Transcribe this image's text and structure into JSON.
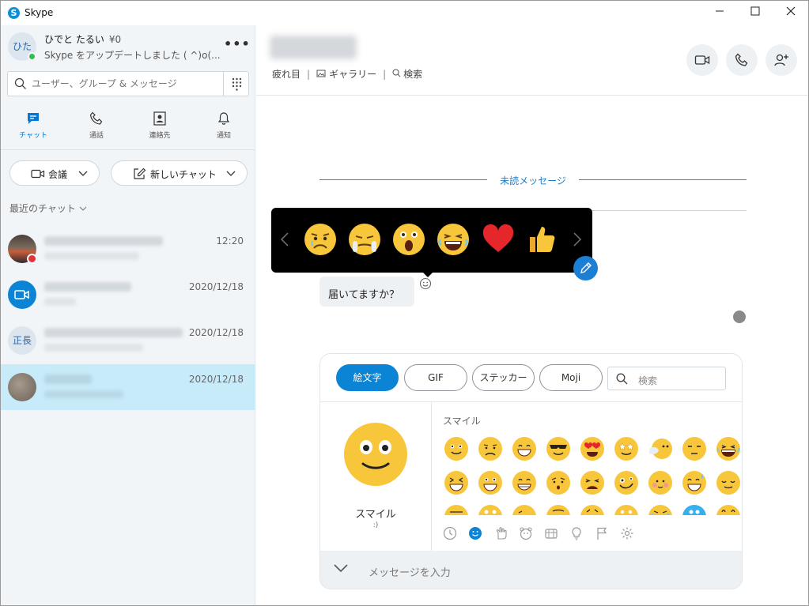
{
  "window": {
    "title": "Skype",
    "logo_letter": "S"
  },
  "profile": {
    "initials": "ひた",
    "name": "ひでと たるい",
    "credit": "¥0",
    "status": "Skype をアップデートしました ( ^)o(..."
  },
  "search": {
    "placeholder": "ユーザー、グループ & メッセージ"
  },
  "nav": [
    {
      "label": "チャット"
    },
    {
      "label": "通話"
    },
    {
      "label": "連絡先"
    },
    {
      "label": "通知"
    }
  ],
  "buttons": {
    "meet": "会議",
    "new_chat": "新しいチャット"
  },
  "recent_label": "最近のチャット",
  "chats": [
    {
      "time": "12:20"
    },
    {
      "time": "2020/12/18"
    },
    {
      "initials": "正長",
      "time": "2020/12/18"
    },
    {
      "time": "2020/12/18"
    }
  ],
  "chat_header": {
    "links": [
      "疲れ目",
      "ギャラリー",
      "検索"
    ]
  },
  "conversation": {
    "unread_label": "未読メッセージ",
    "message": "届いてますか？"
  },
  "reactions": [
    "worried",
    "crying",
    "surprised",
    "laughing-tears",
    "heart",
    "thumbs-up"
  ],
  "emoji_panel": {
    "tabs": [
      "絵文字",
      "GIF",
      "ステッカー",
      "Moji"
    ],
    "search_placeholder": "検索",
    "preview_name": "スマイル",
    "preview_code": ":)",
    "category_title": "スマイル",
    "input_placeholder": "メッセージを入力",
    "categories": [
      "recent-icon",
      "smiley-icon",
      "hand-icon",
      "animal-icon",
      "food-icon",
      "idea-icon",
      "flag-icon",
      "settings-icon"
    ]
  },
  "colors": {
    "accent": "#0c84d6",
    "emoji_yellow": "#f8c63a",
    "selected_row": "#c8ebfa"
  }
}
